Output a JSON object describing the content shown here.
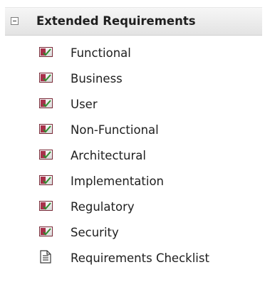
{
  "group": {
    "title": "Extended Requirements",
    "collapse_icon": "minus-box-icon"
  },
  "items": [
    {
      "label": "Functional",
      "icon": "requirement-checkbox-icon"
    },
    {
      "label": "Business",
      "icon": "requirement-checkbox-icon"
    },
    {
      "label": "User",
      "icon": "requirement-checkbox-icon"
    },
    {
      "label": "Non-Functional",
      "icon": "requirement-checkbox-icon"
    },
    {
      "label": "Architectural",
      "icon": "requirement-checkbox-icon"
    },
    {
      "label": "Implementation",
      "icon": "requirement-checkbox-icon"
    },
    {
      "label": "Regulatory",
      "icon": "requirement-checkbox-icon"
    },
    {
      "label": "Security",
      "icon": "requirement-checkbox-icon"
    },
    {
      "label": "Requirements Checklist",
      "icon": "checklist-document-icon"
    }
  ],
  "colors": {
    "requirement_accent": "#a8304a",
    "check_green": "#2e8b2e",
    "header_bg": "#eeeeee"
  }
}
